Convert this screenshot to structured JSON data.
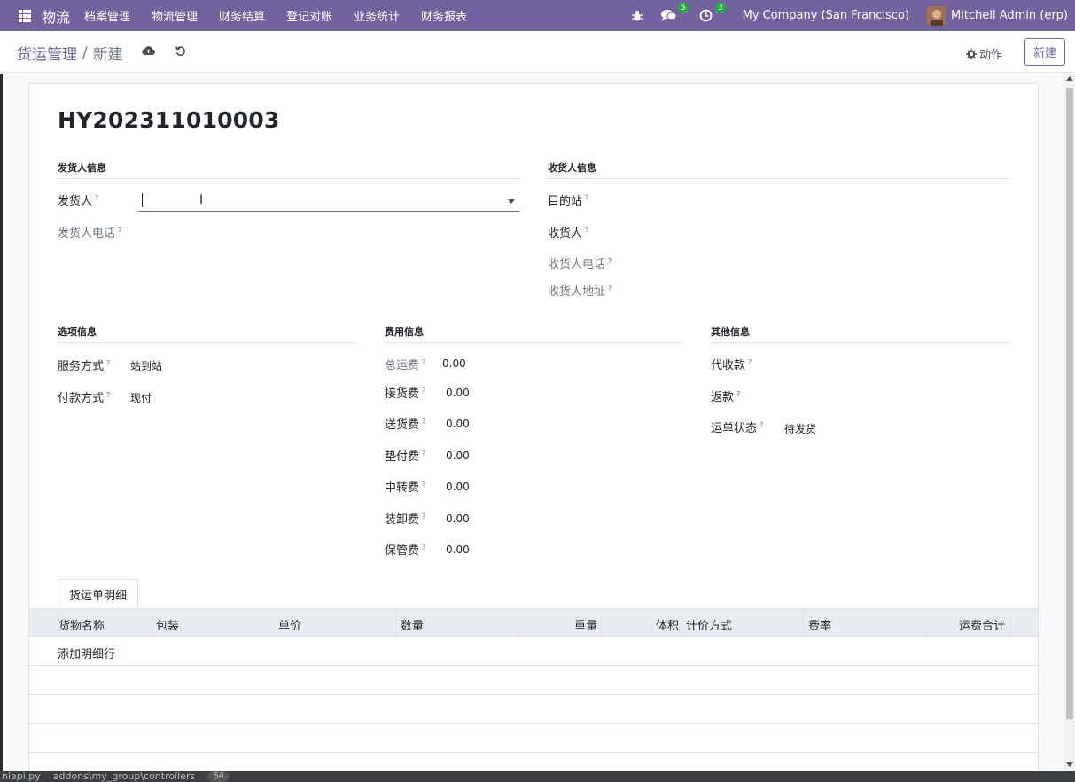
{
  "nav": {
    "brand": "物流",
    "menu": [
      "档案管理",
      "物流管理",
      "财务结算",
      "登记对账",
      "业务统计",
      "财务报表"
    ],
    "messages_count": "5",
    "activities_count": "3",
    "company": "My Company (San Francisco)",
    "user": "Mitchell Admin (erp)"
  },
  "control": {
    "breadcrumb_root": "货运管理",
    "breadcrumb_sep": "/",
    "breadcrumb_current": "新建",
    "action_label": "动作",
    "new_label": "新建"
  },
  "record": {
    "title": "HY202311010003"
  },
  "shipper": {
    "group_title": "发货人信息",
    "shipper_label": "发货人",
    "shipper_value": "",
    "phone_label": "发货人电话"
  },
  "consignee": {
    "group_title": "收货人信息",
    "dest_label": "目的站",
    "consignee_label": "收货人",
    "phone_label": "收货人电话",
    "address_label": "收货人地址"
  },
  "options": {
    "group_title": "选项信息",
    "service_label": "服务方式",
    "service_value": "站到站",
    "payment_label": "付款方式",
    "payment_value": "现付"
  },
  "fees": {
    "group_title": "费用信息",
    "items": [
      {
        "label": "总运费",
        "value": "0.00"
      },
      {
        "label": "接货费",
        "value": "0.00"
      },
      {
        "label": "送货费",
        "value": "0.00"
      },
      {
        "label": "垫付费",
        "value": "0.00"
      },
      {
        "label": "中转费",
        "value": "0.00"
      },
      {
        "label": "装卸费",
        "value": "0.00"
      },
      {
        "label": "保管费",
        "value": "0.00"
      }
    ]
  },
  "other": {
    "group_title": "其他信息",
    "cod_label": "代收款",
    "rebate_label": "返款",
    "status_label": "运单状态",
    "status_value": "待发货"
  },
  "notebook": {
    "tab": "货运单明细",
    "columns": [
      "货物名称",
      "包装",
      "单价",
      "数量",
      "重量",
      "体积",
      "计价方式",
      "费率",
      "运费合计"
    ],
    "add_line": "添加明细行"
  },
  "taskbar": {
    "file": "nlapi.py",
    "path": "addons\\my_group\\controllers",
    "count": "64"
  },
  "colors": {
    "brand": "#71639e",
    "badge": "#28a745"
  }
}
